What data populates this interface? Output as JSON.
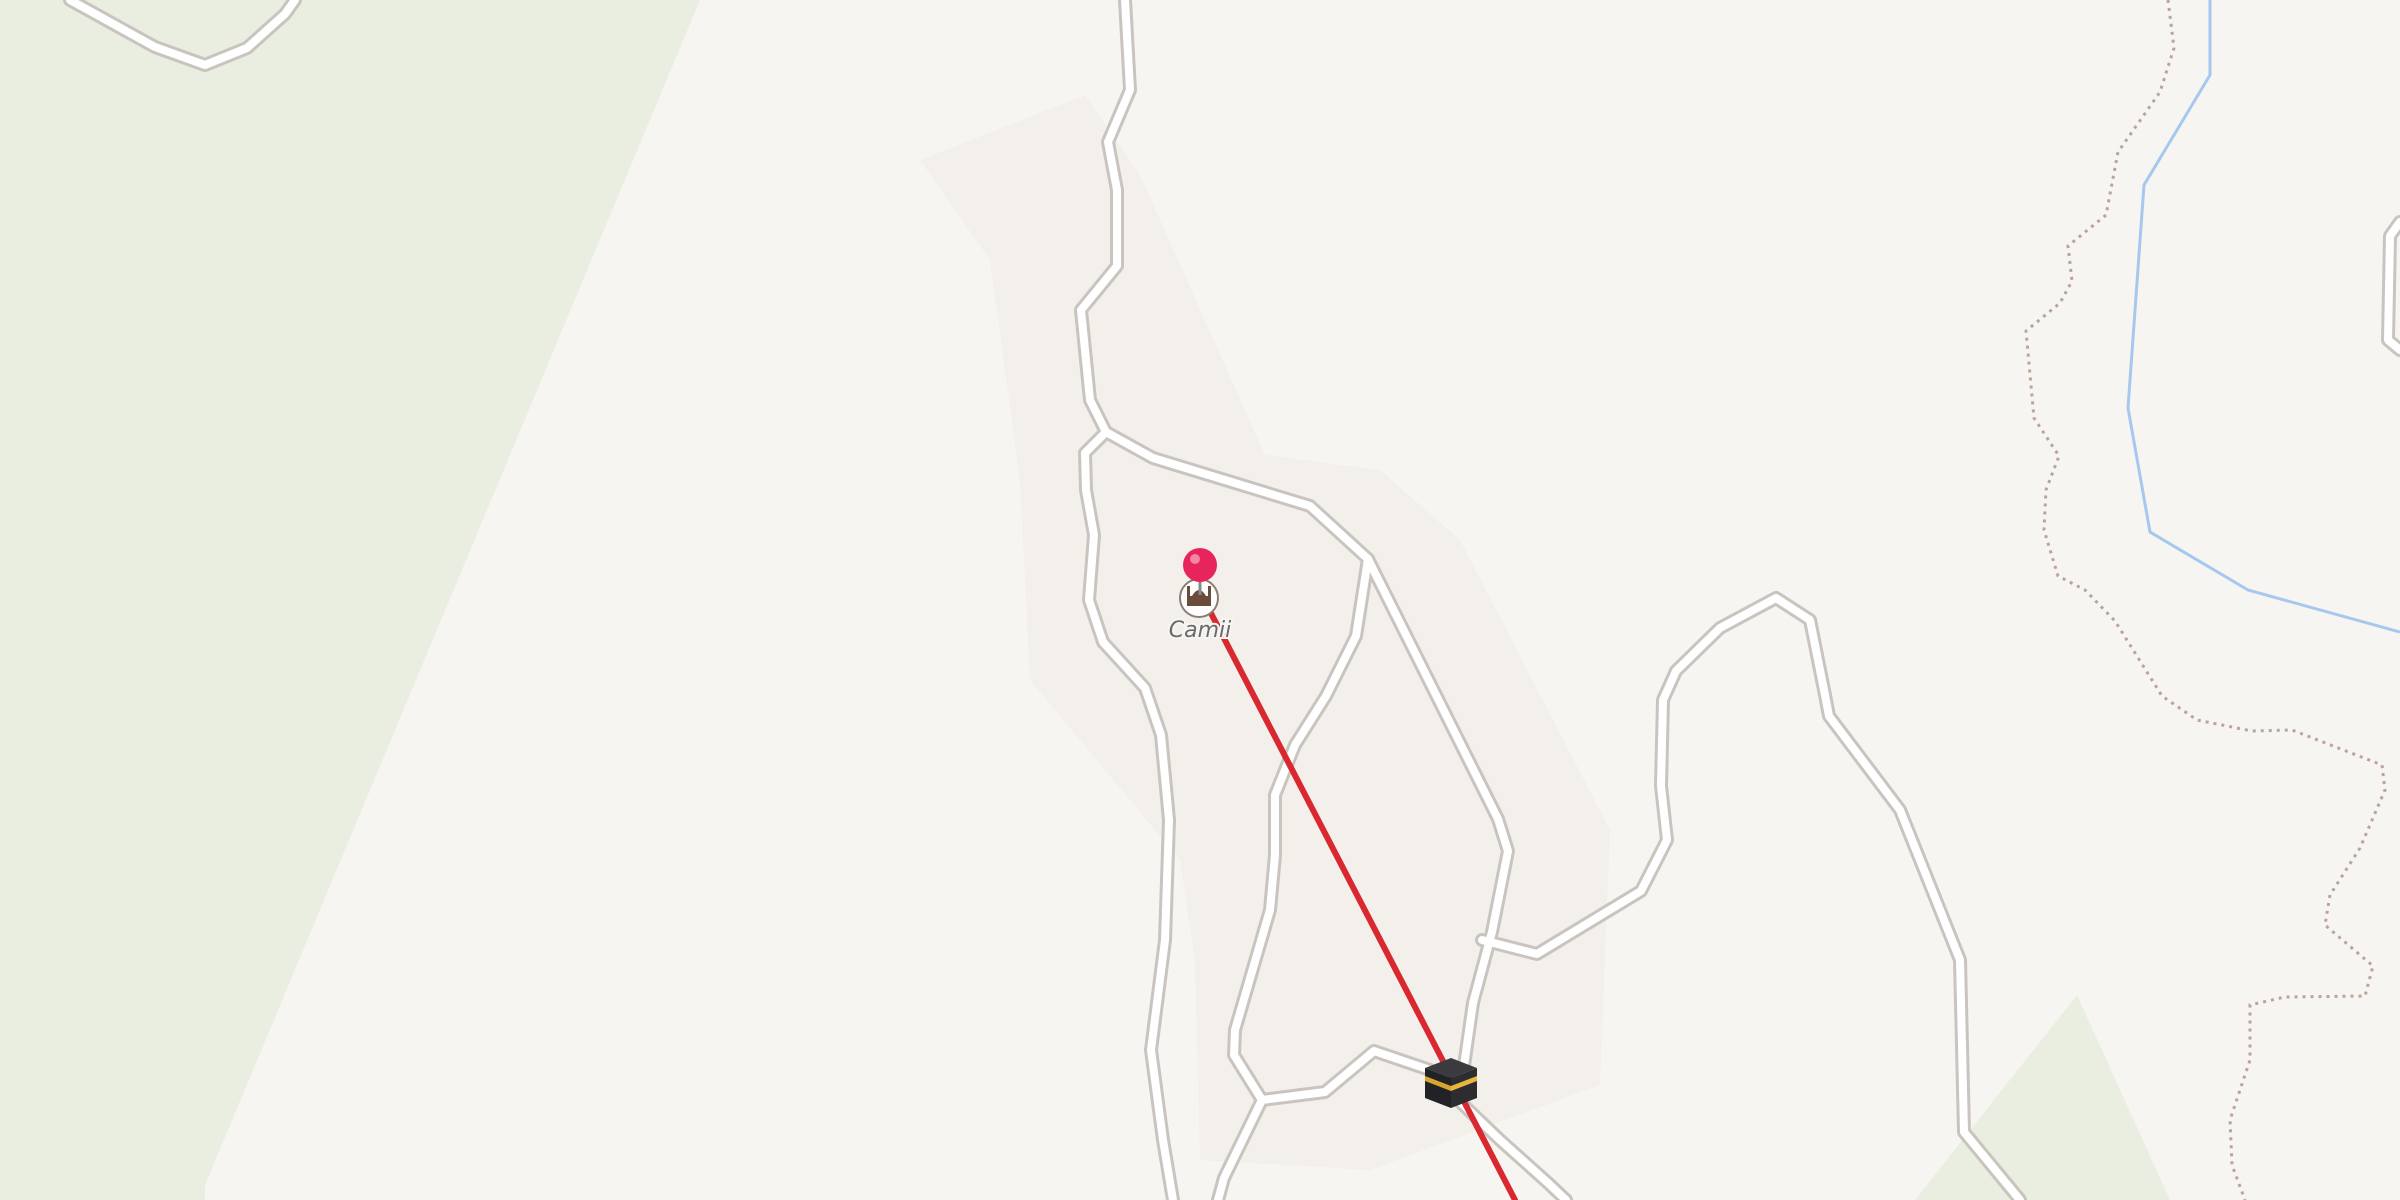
{
  "map": {
    "poi": {
      "label": "Camii",
      "icon": "mosque-icon"
    },
    "kaaba_marker": {
      "icon": "kaaba-icon"
    },
    "location_pin": {
      "icon": "location-pin-icon",
      "color": "#e8245c"
    },
    "qibla_line": {
      "color": "#d9282f"
    },
    "colors": {
      "background": "#f7f5f1",
      "park": "#e9eee1",
      "landuse": "#f3f0ec",
      "road_casing": "#c9c4be",
      "road_fill": "#ffffff",
      "river": "#a6c8ef",
      "boundary": "#bba39a"
    }
  }
}
